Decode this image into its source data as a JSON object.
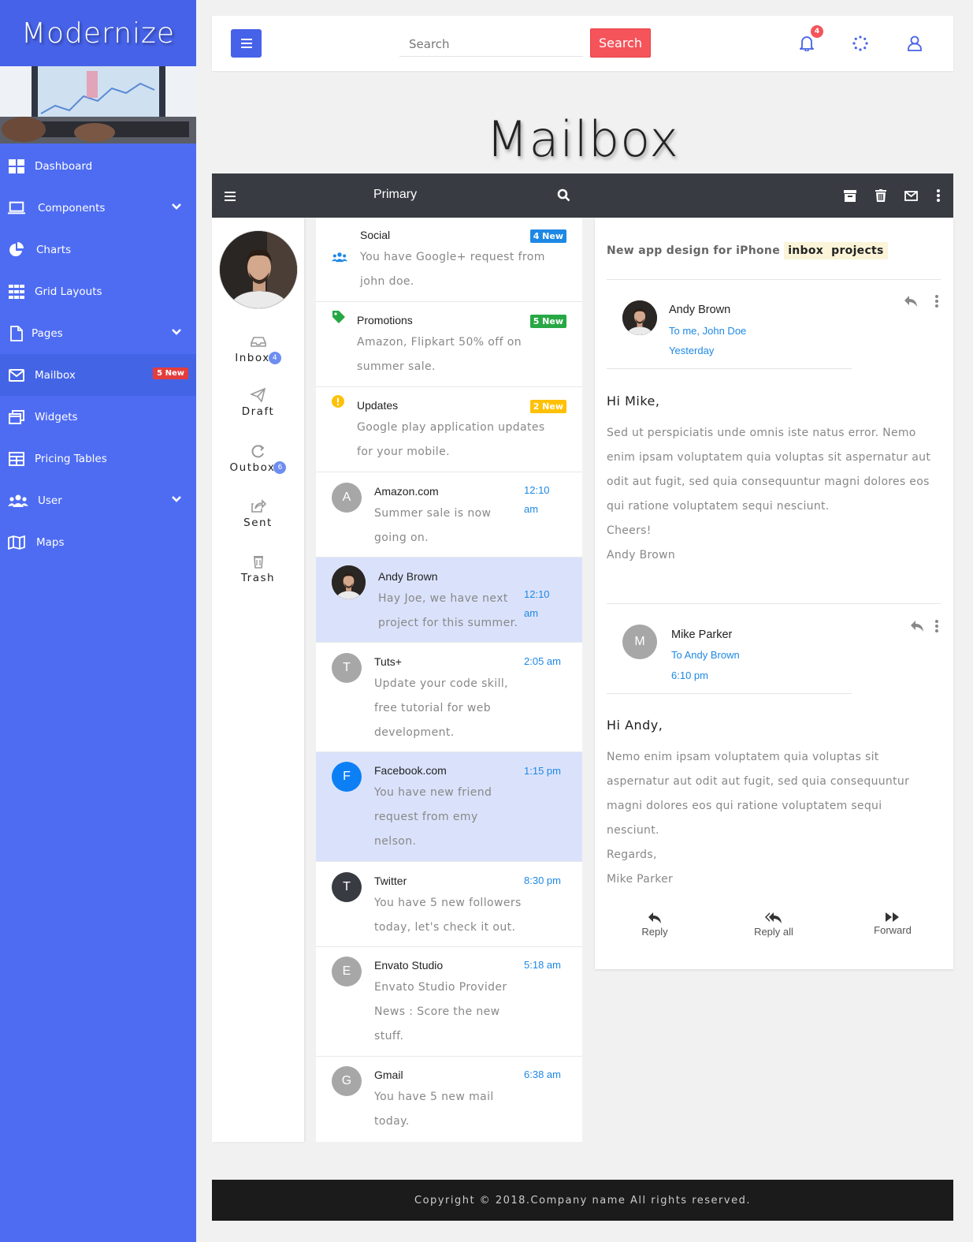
{
  "brand": "Modernize",
  "sidebar": {
    "items": [
      {
        "label": "Dashboard",
        "icon": "dashboard-icon"
      },
      {
        "label": "Components",
        "icon": "laptop-icon",
        "caret": true
      },
      {
        "label": "Charts",
        "icon": "pie-chart-icon"
      },
      {
        "label": "Grid Layouts",
        "icon": "grid-icon"
      },
      {
        "label": "Pages",
        "icon": "file-icon",
        "caret": true
      },
      {
        "label": "Mailbox",
        "icon": "envelope-icon",
        "badge": "5 New",
        "active": true
      },
      {
        "label": "Widgets",
        "icon": "window-icon"
      },
      {
        "label": "Pricing Tables",
        "icon": "table-icon"
      },
      {
        "label": "User",
        "icon": "users-icon",
        "caret": true
      },
      {
        "label": "Maps",
        "icon": "map-icon"
      }
    ]
  },
  "topbar": {
    "search_placeholder": "Search",
    "search_button": "Search",
    "notification_count": "4"
  },
  "page_title": "Mailbox",
  "mailbar": {
    "title": "Primary"
  },
  "folders": [
    {
      "label": "Inbox",
      "badge": "4"
    },
    {
      "label": "Draft"
    },
    {
      "label": "Outbox",
      "badge": "6"
    },
    {
      "label": "Sent"
    },
    {
      "label": "Trash"
    }
  ],
  "categories": [
    {
      "name": "Social",
      "badge": "4 New",
      "badge_color": "#1e88e5",
      "icon_color": "#1e88e5",
      "snippet": "You have Google+ request from john doe."
    },
    {
      "name": "Promotions",
      "badge": "5 New",
      "badge_color": "#28a745",
      "icon_color": "#28a745",
      "snippet": "Amazon, Flipkart 50% off on summer sale."
    },
    {
      "name": "Updates",
      "badge": "2 New",
      "badge_color": "#ffc107",
      "icon_color": "#ffc107",
      "snippet": "Google play application updates for your mobile."
    }
  ],
  "messages": [
    {
      "initial": "A",
      "name": "Amazon.com",
      "time": "12:10 am",
      "snippet": "Summer sale is now going on.",
      "avatar_color": "#a7a7a7"
    },
    {
      "initial": "",
      "name": "Andy Brown",
      "time": "12:10 am",
      "snippet": "Hay Joe, we have next project for this summer.",
      "avatar_color": "#222222",
      "highlight": true
    },
    {
      "initial": "T",
      "name": "Tuts+",
      "time": "2:05 am",
      "snippet": "Update your code skill, free tutorial for web development.",
      "avatar_color": "#a7a7a7"
    },
    {
      "initial": "F",
      "name": "Facebook.com",
      "time": "1:15 pm",
      "snippet": "You have new friend request from emy nelson.",
      "avatar_color": "#0d7ff5",
      "highlight": true
    },
    {
      "initial": "T",
      "name": "Twitter",
      "time": "8:30 pm",
      "snippet": "You have 5 new followers today, let's check it out.",
      "avatar_color": "#383b42"
    },
    {
      "initial": "E",
      "name": "Envato Studio",
      "time": "5:18 am",
      "snippet": "Envato Studio Provider News : Score the new stuff.",
      "avatar_color": "#a7a7a7"
    },
    {
      "initial": "G",
      "name": "Gmail",
      "time": "6:38 am",
      "snippet": "You have 5 new mail today.",
      "avatar_color": "#a7a7a7"
    }
  ],
  "detail": {
    "subject_prefix": "New app design for iPhone",
    "tags": [
      "inbox",
      "projects"
    ],
    "thread": [
      {
        "from": "Andy Brown",
        "to": "To me, John Doe",
        "when": "Yesterday",
        "greeting": "Hi Mike,",
        "body": "Sed ut perspiciatis unde omnis iste natus error. Nemo enim ipsam voluptatem quia voluptas sit aspernatur aut odit aut fugit, sed quia consequuntur magni dolores eos qui ratione voluptatem sequi nesciunt.",
        "closing": "Cheers!",
        "signature": "Andy Brown"
      },
      {
        "from": "Mike Parker",
        "initial": "M",
        "to": "To Andy Brown",
        "when": "6:10 pm",
        "greeting": "Hi Andy,",
        "body": "Nemo enim ipsam voluptatem quia voluptas sit aspernatur aut odit aut fugit, sed quia consequuntur magni dolores eos qui ratione voluptatem sequi nesciunt.",
        "closing": "Regards,",
        "signature": "Mike Parker"
      }
    ],
    "actions": {
      "reply": "Reply",
      "reply_all": "Reply all",
      "forward": "Forward"
    }
  },
  "footer": "Copyright © 2018.Company name All rights reserved.",
  "colors": {
    "sidebar": "#4e6cf2",
    "accent": "#4662e8",
    "danger": "#f4545a",
    "link": "#1e88e5"
  }
}
